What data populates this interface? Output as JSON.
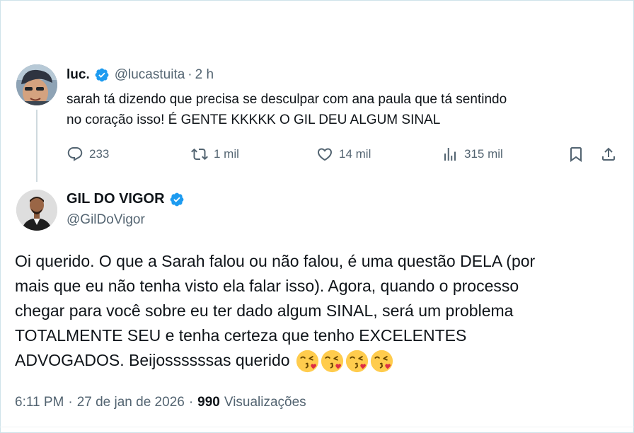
{
  "parent_tweet": {
    "display_name": "luc.",
    "handle": "@lucastuita",
    "separator": "·",
    "time_ago": "2 h",
    "text_lines": [
      "sarah tá dizendo que precisa se desculpar com ana paula que tá sentindo",
      "no coração isso! É GENTE KKKKK O GIL DEU ALGUM SINAL"
    ],
    "actions": {
      "replies": "233",
      "reposts": "1 mil",
      "likes": "14 mil",
      "views": "315 mil"
    },
    "icons": [
      "reply-icon",
      "repost-icon",
      "like-icon",
      "views-icon",
      "bookmark-icon",
      "share-icon"
    ]
  },
  "main_tweet": {
    "display_name": "GIL DO VIGOR",
    "handle": "@GilDoVigor",
    "text_lines": [
      "Oi querido. O que a Sarah falou ou não falou, é uma questão DELA (por",
      "mais que eu não tenha visto ela falar isso). Agora, quando o processo",
      "chegar para você sobre eu ter dado algum SINAL, será um problema",
      "TOTALMENTE SEU e tenha certeza que tenho EXCELENTES",
      "ADVOGADOS. Beijossssssas querido"
    ],
    "emoji_count": 4,
    "emoji_name": "face-blowing-a-kiss",
    "timestamp": "6:11 PM",
    "date": "27 de jan de 2026",
    "separator": "·",
    "views_count": "990",
    "views_label": "Visualizações"
  },
  "colors": {
    "text": "#0f1419",
    "secondary": "#536471",
    "verified": "#1d9bf0",
    "thread_line": "#cfd9de"
  }
}
